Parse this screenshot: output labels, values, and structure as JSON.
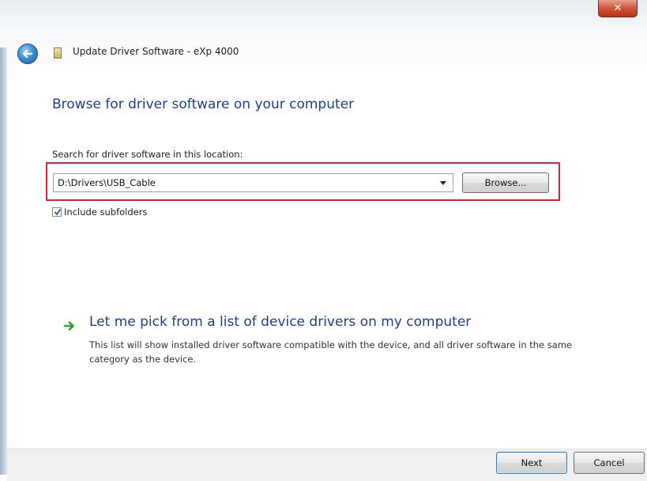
{
  "window": {
    "title": "Update Driver Software - eXp 4000",
    "close_glyph": "✕"
  },
  "page": {
    "heading": "Browse for driver software on your computer",
    "search_label": "Search for driver software in this location:",
    "path_value": "D:\\Drivers\\USB_Cable",
    "browse_label": "Browse...",
    "include_subfolders_label": "Include subfolders",
    "include_subfolders_checked": true
  },
  "option": {
    "title": "Let me pick from a list of device drivers on my computer",
    "description": "This list will show installed driver software compatible with the device, and all driver software in the same category as the device.",
    "arrow_icon": "green-right-arrow-icon"
  },
  "footer": {
    "next_label": "Next",
    "cancel_label": "Cancel"
  },
  "colors": {
    "heading": "#1e3e8f",
    "highlight": "#d8233a",
    "close": "#c8452c",
    "arrow": "#2e9e2e"
  }
}
